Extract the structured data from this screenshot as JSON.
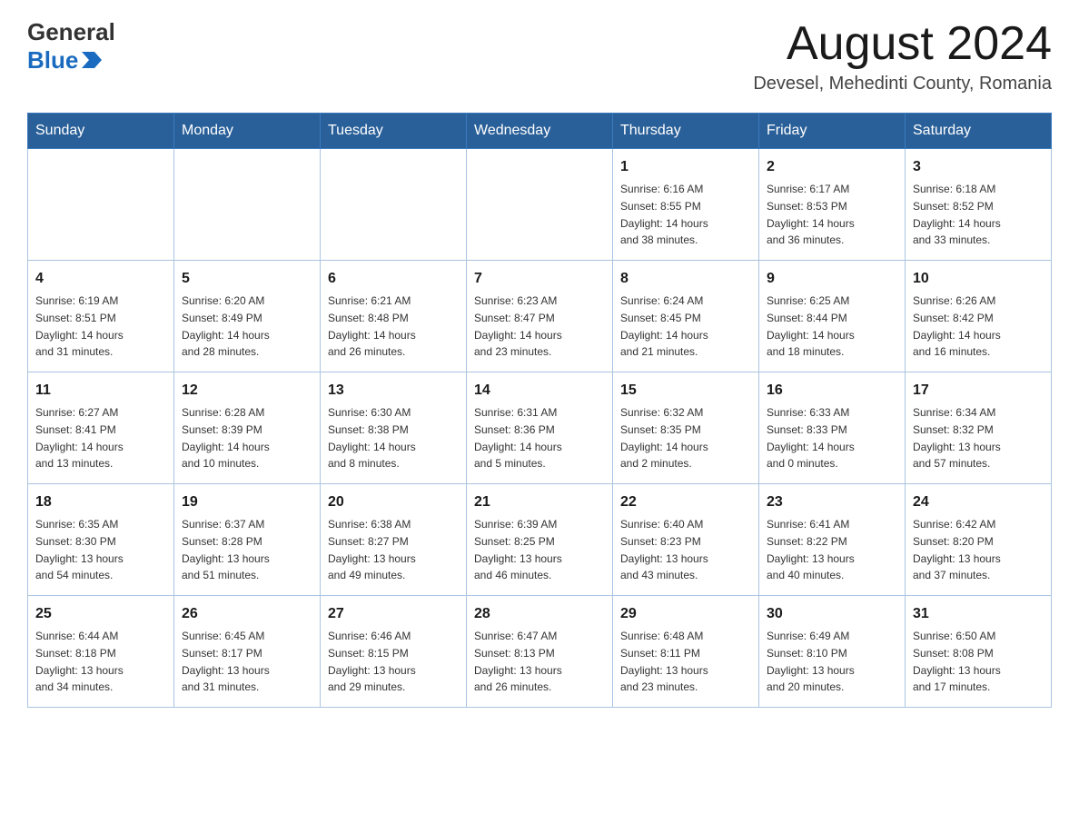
{
  "header": {
    "logo_general": "General",
    "logo_blue": "Blue",
    "month_title": "August 2024",
    "location": "Devesel, Mehedinti County, Romania"
  },
  "days_of_week": [
    "Sunday",
    "Monday",
    "Tuesday",
    "Wednesday",
    "Thursday",
    "Friday",
    "Saturday"
  ],
  "weeks": [
    [
      {
        "day": "",
        "info": ""
      },
      {
        "day": "",
        "info": ""
      },
      {
        "day": "",
        "info": ""
      },
      {
        "day": "",
        "info": ""
      },
      {
        "day": "1",
        "info": "Sunrise: 6:16 AM\nSunset: 8:55 PM\nDaylight: 14 hours\nand 38 minutes."
      },
      {
        "day": "2",
        "info": "Sunrise: 6:17 AM\nSunset: 8:53 PM\nDaylight: 14 hours\nand 36 minutes."
      },
      {
        "day": "3",
        "info": "Sunrise: 6:18 AM\nSunset: 8:52 PM\nDaylight: 14 hours\nand 33 minutes."
      }
    ],
    [
      {
        "day": "4",
        "info": "Sunrise: 6:19 AM\nSunset: 8:51 PM\nDaylight: 14 hours\nand 31 minutes."
      },
      {
        "day": "5",
        "info": "Sunrise: 6:20 AM\nSunset: 8:49 PM\nDaylight: 14 hours\nand 28 minutes."
      },
      {
        "day": "6",
        "info": "Sunrise: 6:21 AM\nSunset: 8:48 PM\nDaylight: 14 hours\nand 26 minutes."
      },
      {
        "day": "7",
        "info": "Sunrise: 6:23 AM\nSunset: 8:47 PM\nDaylight: 14 hours\nand 23 minutes."
      },
      {
        "day": "8",
        "info": "Sunrise: 6:24 AM\nSunset: 8:45 PM\nDaylight: 14 hours\nand 21 minutes."
      },
      {
        "day": "9",
        "info": "Sunrise: 6:25 AM\nSunset: 8:44 PM\nDaylight: 14 hours\nand 18 minutes."
      },
      {
        "day": "10",
        "info": "Sunrise: 6:26 AM\nSunset: 8:42 PM\nDaylight: 14 hours\nand 16 minutes."
      }
    ],
    [
      {
        "day": "11",
        "info": "Sunrise: 6:27 AM\nSunset: 8:41 PM\nDaylight: 14 hours\nand 13 minutes."
      },
      {
        "day": "12",
        "info": "Sunrise: 6:28 AM\nSunset: 8:39 PM\nDaylight: 14 hours\nand 10 minutes."
      },
      {
        "day": "13",
        "info": "Sunrise: 6:30 AM\nSunset: 8:38 PM\nDaylight: 14 hours\nand 8 minutes."
      },
      {
        "day": "14",
        "info": "Sunrise: 6:31 AM\nSunset: 8:36 PM\nDaylight: 14 hours\nand 5 minutes."
      },
      {
        "day": "15",
        "info": "Sunrise: 6:32 AM\nSunset: 8:35 PM\nDaylight: 14 hours\nand 2 minutes."
      },
      {
        "day": "16",
        "info": "Sunrise: 6:33 AM\nSunset: 8:33 PM\nDaylight: 14 hours\nand 0 minutes."
      },
      {
        "day": "17",
        "info": "Sunrise: 6:34 AM\nSunset: 8:32 PM\nDaylight: 13 hours\nand 57 minutes."
      }
    ],
    [
      {
        "day": "18",
        "info": "Sunrise: 6:35 AM\nSunset: 8:30 PM\nDaylight: 13 hours\nand 54 minutes."
      },
      {
        "day": "19",
        "info": "Sunrise: 6:37 AM\nSunset: 8:28 PM\nDaylight: 13 hours\nand 51 minutes."
      },
      {
        "day": "20",
        "info": "Sunrise: 6:38 AM\nSunset: 8:27 PM\nDaylight: 13 hours\nand 49 minutes."
      },
      {
        "day": "21",
        "info": "Sunrise: 6:39 AM\nSunset: 8:25 PM\nDaylight: 13 hours\nand 46 minutes."
      },
      {
        "day": "22",
        "info": "Sunrise: 6:40 AM\nSunset: 8:23 PM\nDaylight: 13 hours\nand 43 minutes."
      },
      {
        "day": "23",
        "info": "Sunrise: 6:41 AM\nSunset: 8:22 PM\nDaylight: 13 hours\nand 40 minutes."
      },
      {
        "day": "24",
        "info": "Sunrise: 6:42 AM\nSunset: 8:20 PM\nDaylight: 13 hours\nand 37 minutes."
      }
    ],
    [
      {
        "day": "25",
        "info": "Sunrise: 6:44 AM\nSunset: 8:18 PM\nDaylight: 13 hours\nand 34 minutes."
      },
      {
        "day": "26",
        "info": "Sunrise: 6:45 AM\nSunset: 8:17 PM\nDaylight: 13 hours\nand 31 minutes."
      },
      {
        "day": "27",
        "info": "Sunrise: 6:46 AM\nSunset: 8:15 PM\nDaylight: 13 hours\nand 29 minutes."
      },
      {
        "day": "28",
        "info": "Sunrise: 6:47 AM\nSunset: 8:13 PM\nDaylight: 13 hours\nand 26 minutes."
      },
      {
        "day": "29",
        "info": "Sunrise: 6:48 AM\nSunset: 8:11 PM\nDaylight: 13 hours\nand 23 minutes."
      },
      {
        "day": "30",
        "info": "Sunrise: 6:49 AM\nSunset: 8:10 PM\nDaylight: 13 hours\nand 20 minutes."
      },
      {
        "day": "31",
        "info": "Sunrise: 6:50 AM\nSunset: 8:08 PM\nDaylight: 13 hours\nand 17 minutes."
      }
    ]
  ]
}
